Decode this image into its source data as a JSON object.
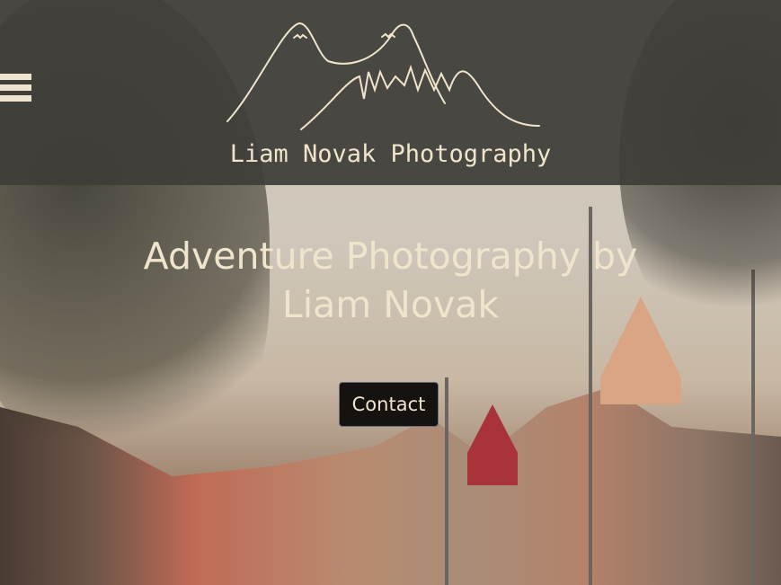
{
  "header": {
    "site_title": "Liam Novak Photography",
    "menu_icon": "hamburger-icon",
    "logo": "mountain-logo"
  },
  "hero": {
    "heading_line1": "Adventure Photography by",
    "heading_line2": "Liam Novak",
    "contact_label": "Contact"
  },
  "colors": {
    "accent": "#efe4cc",
    "header_bg": "#3e3d38",
    "button_bg": "#15120f"
  }
}
